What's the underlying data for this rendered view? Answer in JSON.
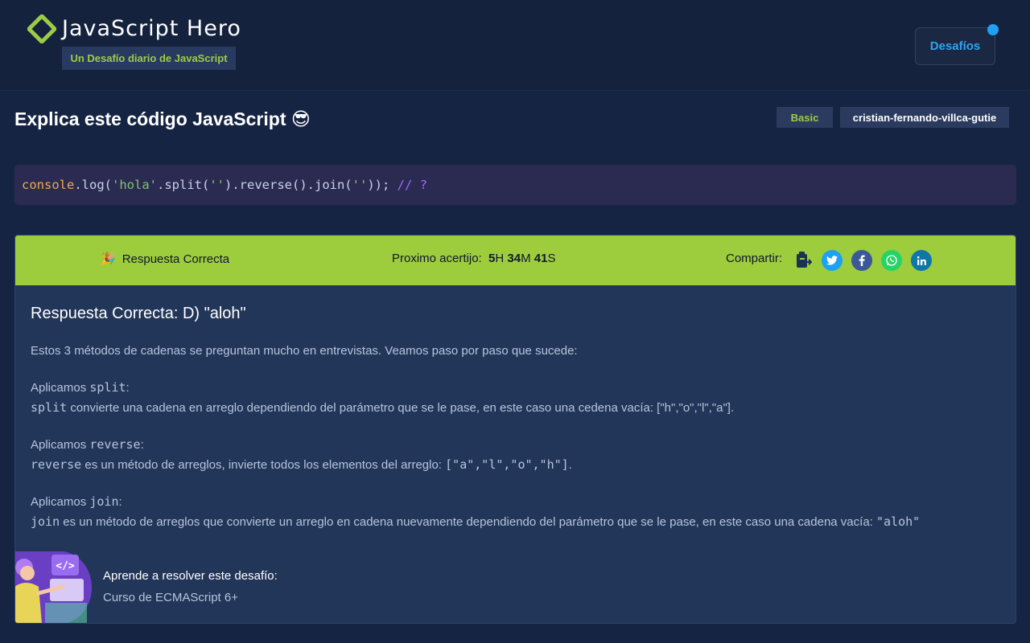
{
  "header": {
    "title": "JavaScript Hero",
    "subtitle": "Un Desafío diario de JavaScript",
    "nav_button": "Desafíos",
    "logo_icon": "diamond-logo-icon",
    "brand_color": "#9ccc45"
  },
  "challenge": {
    "title": "Explica este código JavaScript 😎",
    "level": "Basic",
    "author": "cristian-fernando-villca-gutie",
    "code": {
      "t1": "console",
      "t2": ".log(",
      "t3": "'hola'",
      "t4": ".split(",
      "t5": "''",
      "t6": ").reverse().join(",
      "t7": "''",
      "t8": ")); ",
      "t9": "// ?"
    }
  },
  "result": {
    "status_emoji": "🎉",
    "status": "Respuesta Correcta",
    "next_label": "Proximo acertijo:",
    "countdown": {
      "h": "5",
      "h_unit": "H",
      "m": "34",
      "m_unit": "M",
      "s": "41",
      "s_unit": "S"
    },
    "share_label": "Compartir:",
    "share_icons": [
      "copy-icon",
      "twitter-icon",
      "facebook-icon",
      "whatsapp-icon",
      "linkedin-icon"
    ],
    "bar_color": "#9dcc3d"
  },
  "explanation": {
    "answer_title": "Respuesta Correcta: D) \"aloh\"",
    "intro": "Estos 3 métodos de cadenas se preguntan mucho en entrevistas. Veamos paso por paso que sucede:",
    "step_prefix": "Aplicamos ",
    "colon": ":",
    "split": {
      "name": "split",
      "desc": " convierte una cadena en arreglo dependiendo del parámetro que se le pase, en este caso una cedena vacía: [\"h\",\"o\",\"l\",\"a\"]."
    },
    "reverse": {
      "name": "reverse",
      "desc": " es un método de arreglos, invierte todos los elementos del arreglo: ",
      "result": "[\"a\",\"l\",\"o\",\"h\"]",
      "end": "."
    },
    "join": {
      "name": "join",
      "desc": " es un método de arreglos que convierte un arreglo en cadena nuevamente dependiendo del parámetro que se le pase, en este caso una cadena vacía: ",
      "result": "\"aloh\""
    }
  },
  "course": {
    "label": "Aprende a resolver este desafío:",
    "link": "Curso de ECMAScript 6+",
    "image_code_text": "</>"
  }
}
